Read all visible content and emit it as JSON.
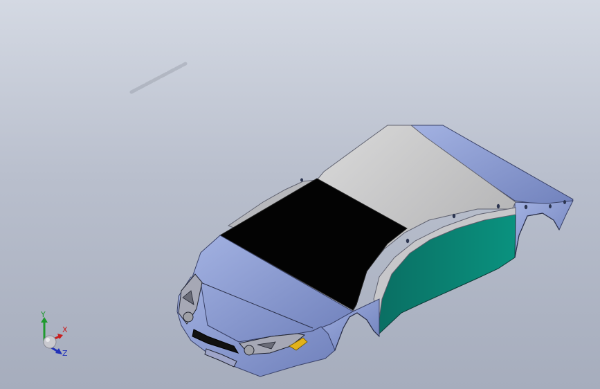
{
  "viewport": {
    "background_top": "#d4d9e3",
    "background_bottom": "#a6adbd"
  },
  "model": {
    "name": "car-body-shell",
    "colors": {
      "body_blue": "#8e9fd4",
      "roof_gray": "#c4c4c6",
      "windshield_black": "#030303",
      "side_panel_teal": "#088072",
      "indicator_yellow": "#e2b21a",
      "dark_edge": "#2a2f48"
    }
  },
  "triad": {
    "x_label": "X",
    "y_label": "Y",
    "z_label": "Z",
    "x_color": "#c81e1e",
    "y_color": "#1f9a2e",
    "z_color": "#2232b8"
  }
}
